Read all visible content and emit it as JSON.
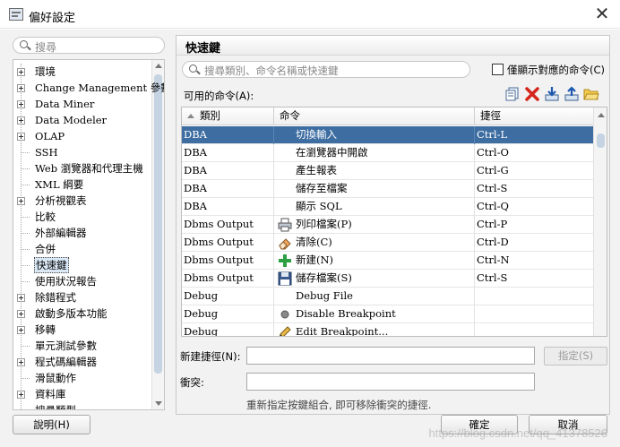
{
  "window": {
    "title": "偏好設定",
    "close_glyph": "✕"
  },
  "left": {
    "search_placeholder": "搜尋",
    "tree": [
      {
        "label": "環境",
        "expandable": true
      },
      {
        "label": "Change Management 參數",
        "expandable": true
      },
      {
        "label": "Data Miner",
        "expandable": true
      },
      {
        "label": "Data Modeler",
        "expandable": true
      },
      {
        "label": "OLAP",
        "expandable": true
      },
      {
        "label": "SSH",
        "expandable": false
      },
      {
        "label": "Web 瀏覽器和代理主機",
        "expandable": false
      },
      {
        "label": "XML 綱要",
        "expandable": false
      },
      {
        "label": "分析視觀表",
        "expandable": true
      },
      {
        "label": "比較",
        "expandable": false
      },
      {
        "label": "外部編輯器",
        "expandable": false
      },
      {
        "label": "合併",
        "expandable": false
      },
      {
        "label": "快速鍵",
        "expandable": false,
        "selected": true
      },
      {
        "label": "使用狀況報告",
        "expandable": false
      },
      {
        "label": "除錯程式",
        "expandable": true
      },
      {
        "label": "啟動多版本功能",
        "expandable": true
      },
      {
        "label": "移轉",
        "expandable": true
      },
      {
        "label": "單元測試參數",
        "expandable": false
      },
      {
        "label": "程式碼編輯器",
        "expandable": true
      },
      {
        "label": "滑鼠動作",
        "expandable": false
      },
      {
        "label": "資料庫",
        "expandable": true
      },
      {
        "label": "搜尋類型",
        "expandable": false
      }
    ]
  },
  "right": {
    "section_title": "快速鍵",
    "search_placeholder": "搜尋類別、命令名稱或快速鍵",
    "only_mapped_label": "僅顯示對應的命令(C)",
    "only_mapped_checked": false,
    "available_label": "可用的命令(A):",
    "toolbar_icons": [
      "copy-icon",
      "delete-icon",
      "import-icon",
      "export-icon",
      "open-folder-icon"
    ],
    "columns": {
      "category": "類別",
      "command": "命令",
      "shortcut": "捷徑"
    },
    "rows": [
      {
        "category": "DBA",
        "command": "切換輸入",
        "shortcut": "Ctrl-L",
        "icon": "",
        "selected": true
      },
      {
        "category": "DBA",
        "command": "在瀏覽器中開啟",
        "shortcut": "Ctrl-O",
        "icon": ""
      },
      {
        "category": "DBA",
        "command": "產生報表",
        "shortcut": "Ctrl-G",
        "icon": ""
      },
      {
        "category": "DBA",
        "command": "儲存至檔案",
        "shortcut": "Ctrl-S",
        "icon": ""
      },
      {
        "category": "DBA",
        "command": "顯示 SQL",
        "shortcut": "Ctrl-Q",
        "icon": ""
      },
      {
        "category": "Dbms Output",
        "command": "列印檔案(P)",
        "shortcut": "Ctrl-P",
        "icon": "printer"
      },
      {
        "category": "Dbms Output",
        "command": "清除(C)",
        "shortcut": "Ctrl-D",
        "icon": "eraser"
      },
      {
        "category": "Dbms Output",
        "command": "新建(N)",
        "shortcut": "Ctrl-N",
        "icon": "plus"
      },
      {
        "category": "Dbms Output",
        "command": "儲存檔案(S)",
        "shortcut": "Ctrl-S",
        "icon": "floppy"
      },
      {
        "category": "Debug",
        "command": "Debug File",
        "shortcut": "",
        "icon": ""
      },
      {
        "category": "Debug",
        "command": "Disable Breakpoint",
        "shortcut": "",
        "icon": "dot"
      },
      {
        "category": "Debug",
        "command": "Edit Breakpoint...",
        "shortcut": "",
        "icon": "pencil"
      }
    ],
    "new_shortcut_label": "新建捷徑(N):",
    "new_shortcut_value": "",
    "conflict_label": "衝突:",
    "conflict_value": "",
    "assign_button": "指定(S)",
    "hint": "重新指定按鍵組合, 即可移除衝突的捷徑."
  },
  "footer": {
    "help_button": "說明(H)",
    "ok_button": "確定",
    "cancel_button": "取消"
  },
  "watermark": "https://blog.csdn.net/qq_41378526"
}
